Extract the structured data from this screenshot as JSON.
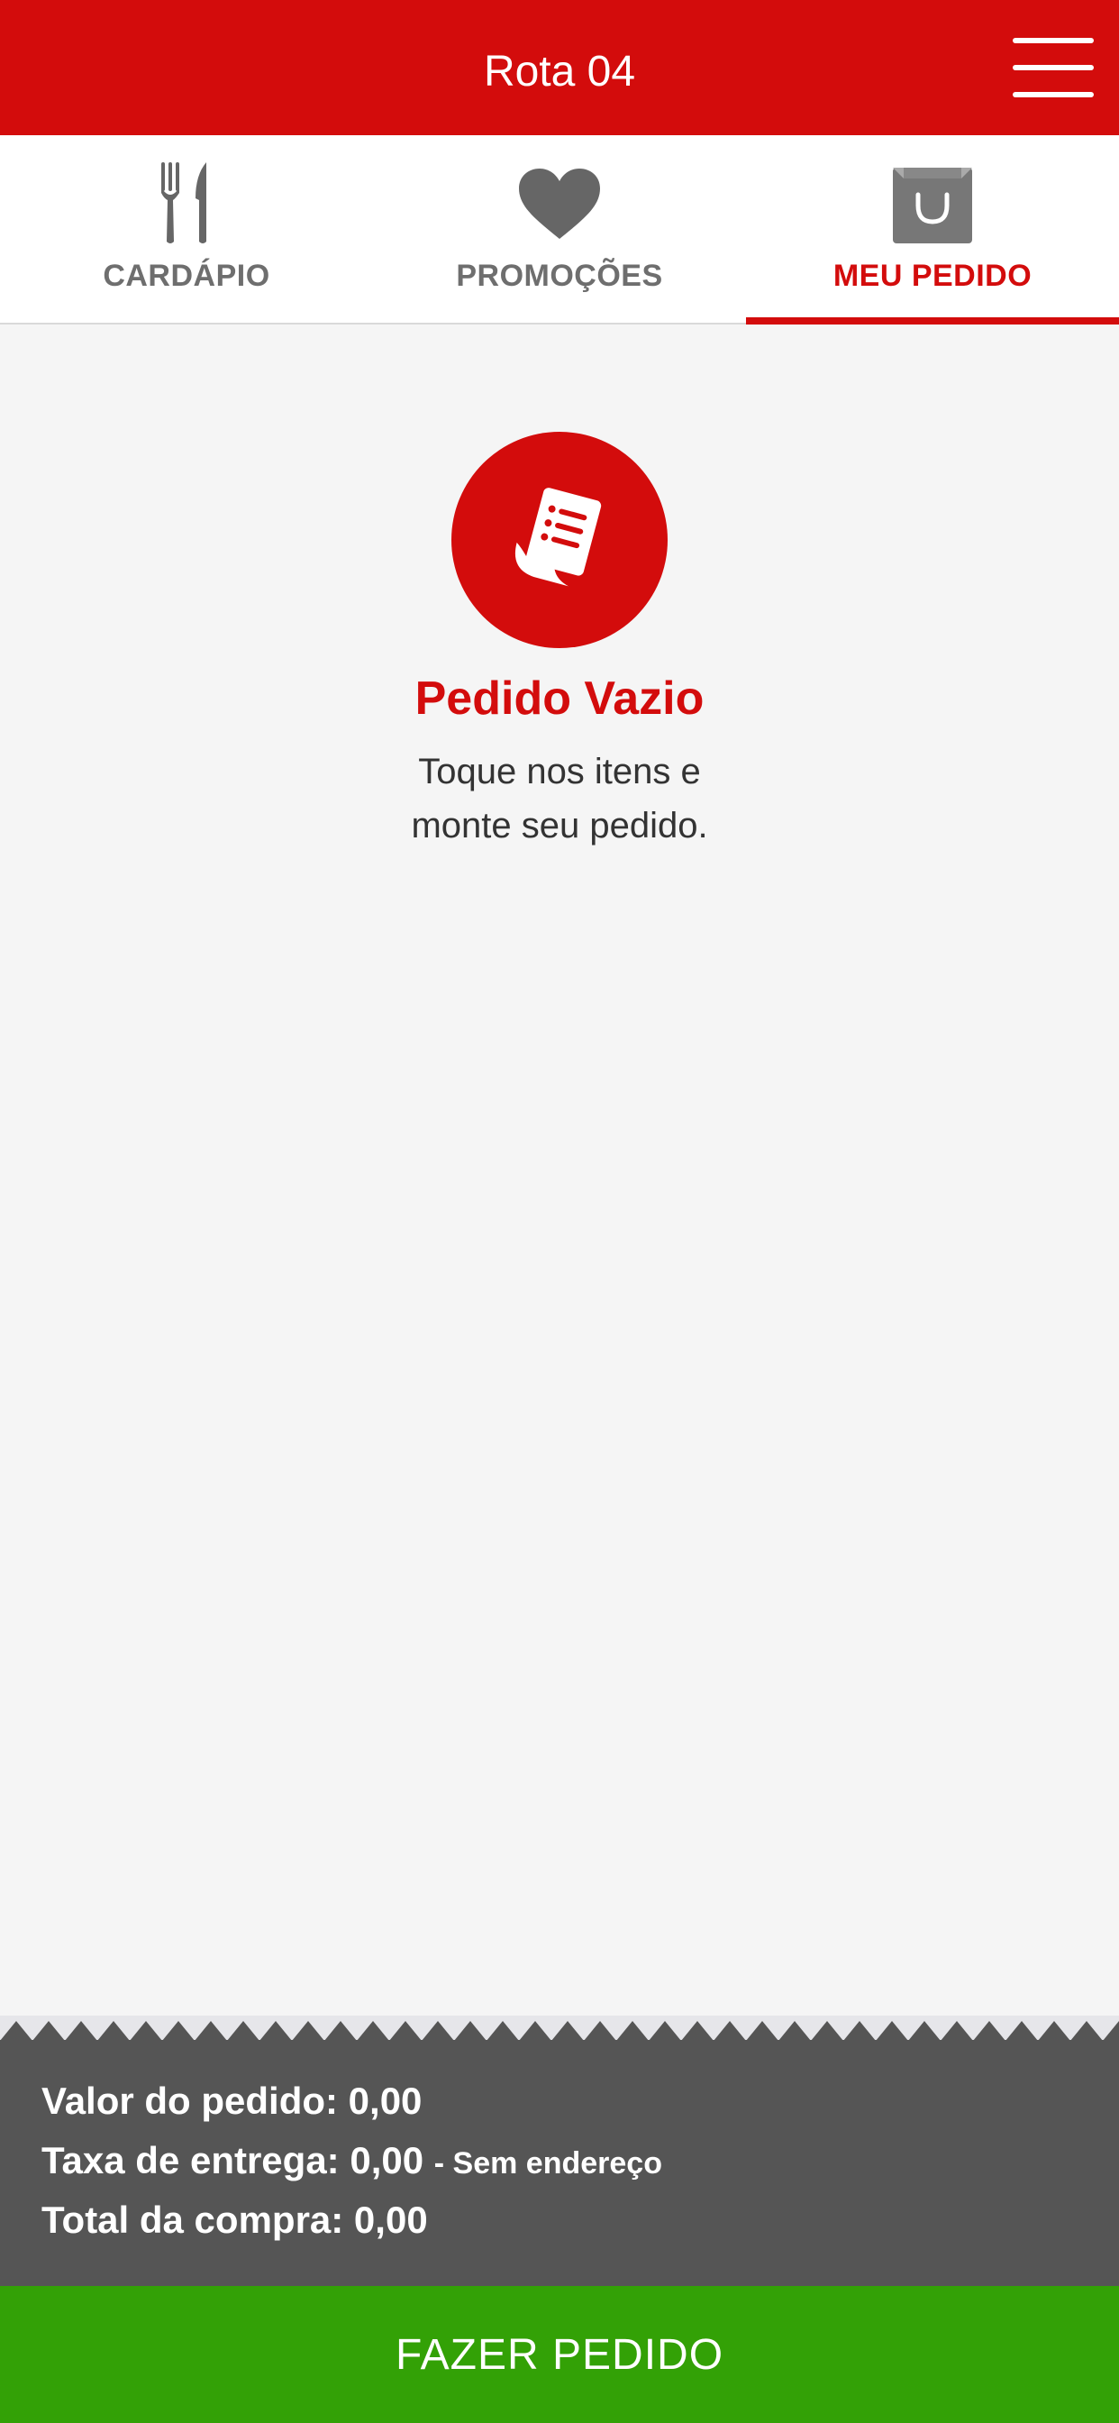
{
  "header": {
    "title": "Rota 04"
  },
  "tabs": [
    {
      "label": "CARDÁPIO",
      "icon": "fork-knife-icon"
    },
    {
      "label": "PROMOÇÕES",
      "icon": "heart-icon"
    },
    {
      "label": "MEU PEDIDO",
      "icon": "shopping-bag-icon",
      "active": true
    }
  ],
  "empty_state": {
    "icon": "receipt-icon",
    "title": "Pedido Vazio",
    "line1": "Toque nos itens e",
    "line2": "monte seu pedido."
  },
  "summary": {
    "order_value": "Valor do pedido: 0,00",
    "delivery_fee": "Taxa de entrega: 0,00",
    "delivery_note": "- Sem endereço",
    "total": "Total da compra: 0,00"
  },
  "order_button": {
    "label": "FAZER PEDIDO"
  },
  "colors": {
    "brand_red": "#d30c0c",
    "tab_gray": "#6e6e6e",
    "summary_bg": "#555555",
    "action_green": "#33a106"
  }
}
